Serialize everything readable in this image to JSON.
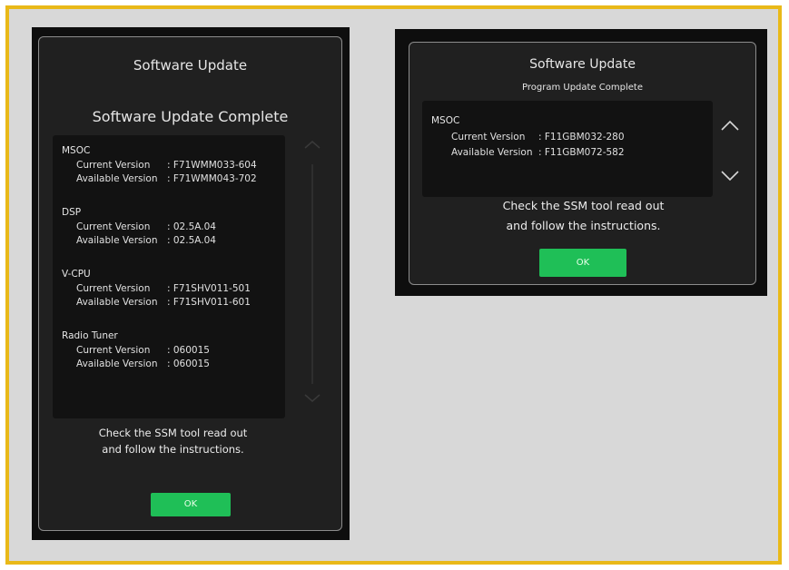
{
  "left_dialog": {
    "header": "Software Update",
    "heading": "Software Update Complete",
    "sections": [
      {
        "name": "MSOC",
        "current_label": "Current Version",
        "current_value": ": F71WMM033-604",
        "available_label": "Available Version",
        "available_value": ": F71WMM043-702"
      },
      {
        "name": "DSP",
        "current_label": "Current Version",
        "current_value": ": 02.5A.04",
        "available_label": "Available Version",
        "available_value": ": 02.5A.04"
      },
      {
        "name": "V-CPU",
        "current_label": "Current Version",
        "current_value": ": F71SHV011-501",
        "available_label": "Available Version",
        "available_value": ": F71SHV011-601"
      },
      {
        "name": "Radio Tuner",
        "current_label": "Current Version",
        "current_value": ": 060015",
        "available_label": "Available Version",
        "available_value": ": 060015"
      }
    ],
    "message_line1": "Check the SSM tool read out",
    "message_line2": "and follow the instructions.",
    "ok_label": "OK"
  },
  "right_dialog": {
    "header": "Software Update",
    "subheading": "Program Update Complete",
    "section": {
      "name": "MSOC",
      "current_label": "Current Version",
      "current_value": ": F11GBM032-280",
      "available_label": "Available Version",
      "available_value": ": F11GBM072-582"
    },
    "message_line1": "Check the SSM tool read out",
    "message_line2": "and follow the instructions.",
    "ok_label": "OK"
  },
  "colors": {
    "border_accent": "#e9b919",
    "ok_button": "#1fbf57",
    "screen_bg": "#0e0e0e"
  },
  "icons": {
    "scroll_up": "chevron-up-icon",
    "scroll_down": "chevron-down-icon"
  }
}
